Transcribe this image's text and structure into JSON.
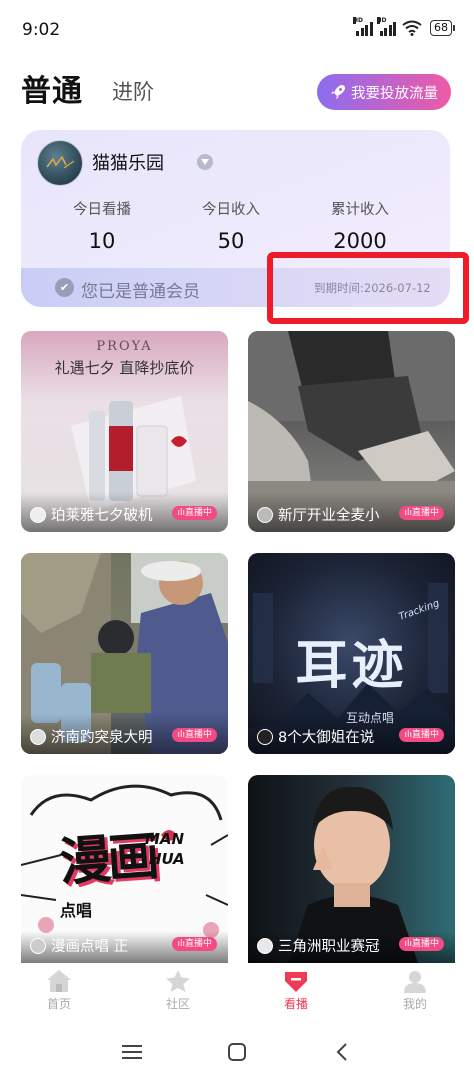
{
  "status_bar": {
    "time": "9:02",
    "battery": "68"
  },
  "header": {
    "tab_normal": "普通",
    "tab_advanced": "进阶",
    "promo_button": "我要投放流量"
  },
  "card": {
    "room_name": "猫猫乐园",
    "stats": [
      {
        "label": "今日看播",
        "value": "10"
      },
      {
        "label": "今日收入",
        "value": "50"
      },
      {
        "label": "累计收入",
        "value": "2000"
      }
    ],
    "vip_text": "您已是普通会员",
    "expire_text": "到期时间:2026-07-12"
  },
  "rooms": [
    {
      "title": "珀莱雅七夕破机",
      "badge": "直播中",
      "poster_brand": "PROYA",
      "poster_text": "礼遇七夕 直降抄底价"
    },
    {
      "title": "新厅开业全麦小",
      "badge": "直播中"
    },
    {
      "title": "济南趵突泉大明",
      "badge": "直播中"
    },
    {
      "title": "8个大御姐在说",
      "badge": "直播中",
      "poster_main": "耳迹",
      "poster_sub": "互动点唱",
      "poster_tag": "Tracking"
    },
    {
      "title": "漫画点唱 正",
      "badge": "直播中",
      "poster_main": "漫画",
      "poster_sub": "点唱",
      "poster_en1": "MAN",
      "poster_en2": "HUA"
    },
    {
      "title": "三角洲职业赛冠",
      "badge": "直播中"
    }
  ],
  "nav": {
    "home": "首页",
    "community": "社区",
    "watch": "看播",
    "me": "我的"
  },
  "colors": {
    "accent": "#ef3b55",
    "live_badge": "#f24a83",
    "annotation_red": "#ee1c29"
  }
}
